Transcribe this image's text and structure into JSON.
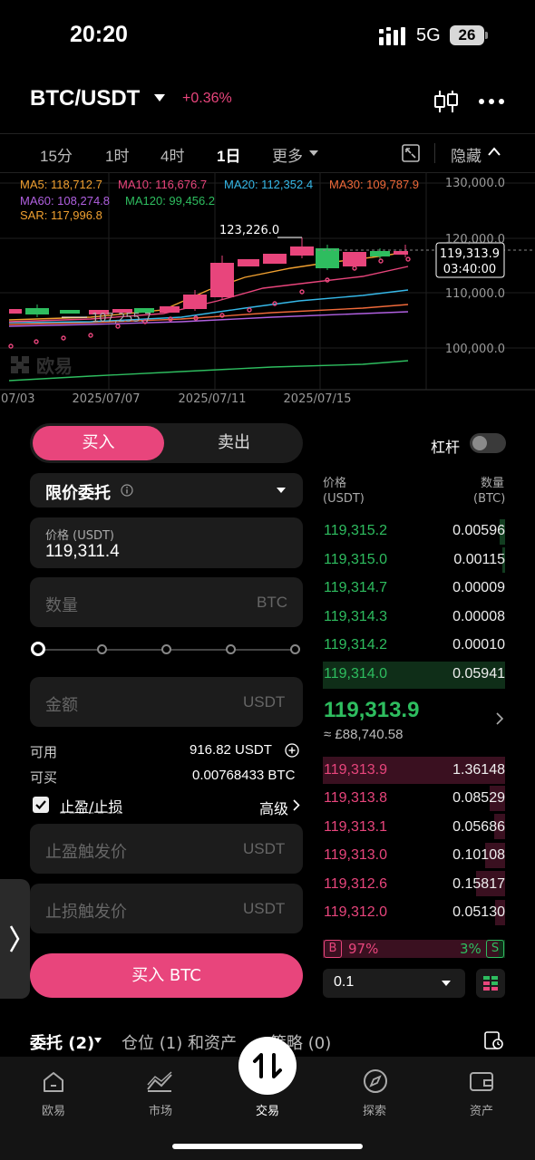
{
  "status_bar": {
    "time": "20:20",
    "network": "5G",
    "battery": "26"
  },
  "header": {
    "pair": "BTC/USDT",
    "change": "+0.36%"
  },
  "timeframes": {
    "items": [
      "15分",
      "1时",
      "4时",
      "1日",
      "更多"
    ],
    "active": "1日",
    "hide_label": "隐藏"
  },
  "indicators": {
    "ma5": "MA5: 118,712.7",
    "ma10": "MA10: 116,676.7",
    "ma20": "MA20: 112,352.4",
    "ma30": "MA30: 109,787.9",
    "ma60": "MA60: 108,274.8",
    "ma120": "MA120: 99,456.2",
    "sar": "SAR: 117,996.8",
    "colors": {
      "ma5": "#f0a030",
      "ma10": "#e8457c",
      "ma20": "#36b8e8",
      "ma30": "#f06a3a",
      "ma60": "#b060e0",
      "ma120": "#2ebd5f",
      "sar": "#f0a030"
    }
  },
  "chart_data": {
    "type": "candlestick",
    "y_ticks": [
      "130,000.0",
      "120,000.0",
      "110,000.0",
      "100,000.0"
    ],
    "x_ticks": [
      "07/03",
      "2025/07/07",
      "2025/07/11",
      "2025/07/15"
    ],
    "high_label": "123,226.0",
    "low_label": "107,255.7",
    "current_price": "119,313.9",
    "countdown": "03:40:00",
    "watermark": "欧易"
  },
  "trade": {
    "buy_tab": "买入",
    "sell_tab": "卖出",
    "leverage_label": "杠杆",
    "order_type": "限价委托",
    "price_label": "价格 (USDT)",
    "price_value": "119,311.4",
    "qty_placeholder": "数量",
    "qty_unit": "BTC",
    "amount_placeholder": "金额",
    "amount_unit": "USDT",
    "available_label": "可用",
    "available_value": "916.82 USDT",
    "buyable_label": "可买",
    "buyable_value": "0.00768433 BTC",
    "tpsl_label": "止盈/止损",
    "advanced_label": "高级",
    "tp_placeholder": "止盈触发价",
    "tp_unit": "USDT",
    "sl_placeholder": "止损触发价",
    "sl_unit": "USDT",
    "buy_button": "买入 BTC"
  },
  "orderbook": {
    "price_header": "价格",
    "price_unit": "(USDT)",
    "qty_header": "数量",
    "qty_unit": "(BTC)",
    "asks": [
      {
        "price": "119,315.2",
        "qty": "0.00596"
      },
      {
        "price": "119,315.0",
        "qty": "0.00115"
      },
      {
        "price": "119,314.7",
        "qty": "0.00009"
      },
      {
        "price": "119,314.3",
        "qty": "0.00008"
      },
      {
        "price": "119,314.2",
        "qty": "0.00010"
      },
      {
        "price": "119,314.0",
        "qty": "0.05941"
      }
    ],
    "last_price": "119,313.9",
    "fiat_price": "≈ £88,740.58",
    "bids": [
      {
        "price": "119,313.9",
        "qty": "1.36148"
      },
      {
        "price": "119,313.8",
        "qty": "0.08529"
      },
      {
        "price": "119,313.1",
        "qty": "0.05686"
      },
      {
        "price": "119,313.0",
        "qty": "0.10108"
      },
      {
        "price": "119,312.6",
        "qty": "0.15817"
      },
      {
        "price": "119,312.0",
        "qty": "0.05130"
      }
    ],
    "buy_ratio_tag": "B",
    "buy_ratio": "97%",
    "sell_ratio": "3%",
    "sell_ratio_tag": "S",
    "precision": "0.1"
  },
  "bottom_tabs": {
    "orders": "委托 (2)",
    "positions": "仓位 (1) 和资产",
    "strategy": "策略 (0)"
  },
  "nav": {
    "home": "欧易",
    "market": "市场",
    "trade": "交易",
    "explore": "探索",
    "assets": "资产"
  }
}
